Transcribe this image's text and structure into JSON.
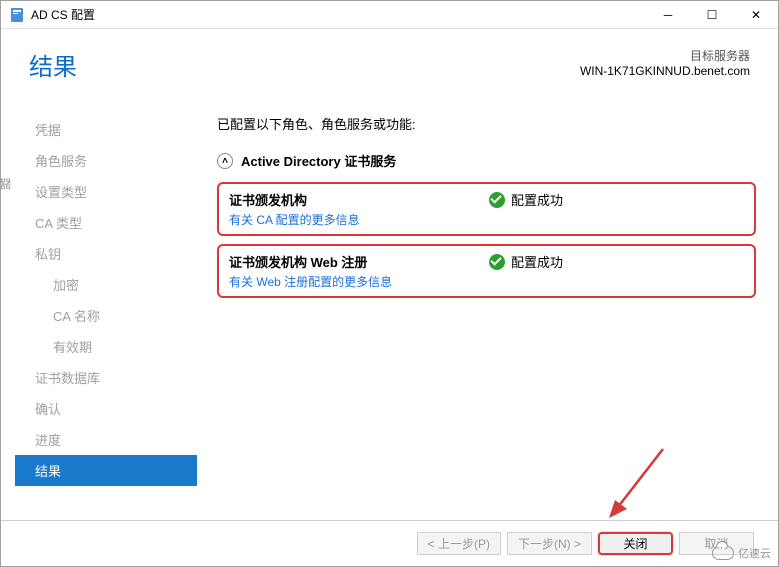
{
  "titlebar": {
    "text": "AD CS 配置"
  },
  "header": {
    "title": "结果",
    "target_label": "目标服务器",
    "target_server": "WIN-1K71GKINNUD.benet.com"
  },
  "sidebar": {
    "items": [
      {
        "label": "凭据",
        "indent": false
      },
      {
        "label": "角色服务",
        "indent": false
      },
      {
        "label": "设置类型",
        "indent": false
      },
      {
        "label": "CA 类型",
        "indent": false
      },
      {
        "label": "私钥",
        "indent": false
      },
      {
        "label": "加密",
        "indent": true
      },
      {
        "label": "CA 名称",
        "indent": true
      },
      {
        "label": "有效期",
        "indent": true
      },
      {
        "label": "证书数据库",
        "indent": false
      },
      {
        "label": "确认",
        "indent": false
      },
      {
        "label": "进度",
        "indent": false
      },
      {
        "label": "结果",
        "indent": false,
        "active": true
      }
    ]
  },
  "content": {
    "intro": "已配置以下角色、角色服务或功能:",
    "section_title": "Active Directory 证书服务",
    "results": [
      {
        "title": "证书颁发机构",
        "status": "配置成功",
        "link": "有关 CA 配置的更多信息"
      },
      {
        "title": "证书颁发机构 Web 注册",
        "status": "配置成功",
        "link": "有关 Web 注册配置的更多信息"
      }
    ]
  },
  "footer": {
    "prev": "< 上一步(P)",
    "next": "下一步(N) >",
    "close": "关闭",
    "cancel": "取消"
  },
  "watermark": "亿速云"
}
